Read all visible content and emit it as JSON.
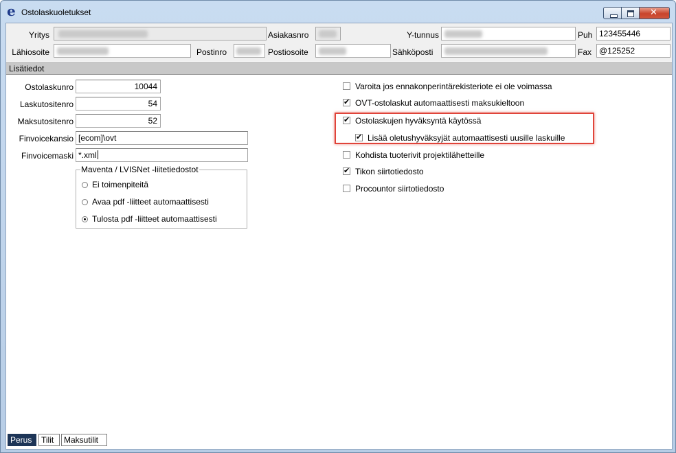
{
  "window": {
    "title": "Ostolaskuoletukset",
    "app_icon": "e"
  },
  "header": {
    "yritys_label": "Yritys",
    "asiakasnro_label": "Asiakasnro",
    "ytunnus_label": "Y-tunnus",
    "puh_label": "Puh",
    "puh_value": "123455446",
    "lahiosoite_label": "Lähiosoite",
    "postinro_label": "Postinro",
    "postiosoite_label": "Postiosoite",
    "sahkoposti_label": "Sähköposti",
    "fax_label": "Fax",
    "fax_value": "@125252"
  },
  "section": {
    "title": "Lisätiedot"
  },
  "numbers": {
    "ostolaskunro_label": "Ostolaskunro",
    "ostolaskunro_value": "10044",
    "laskutositenro_label": "Laskutositenro",
    "laskutositenro_value": "54",
    "maksutositenro_label": "Maksutositenro",
    "maksutositenro_value": "52",
    "finvoicekansio_label": "Finvoicekansio",
    "finvoicekansio_value": "[ecom]\\ovt",
    "finvoicemaski_label": "Finvoicemaski",
    "finvoicemaski_value": "*.xml"
  },
  "attachments": {
    "legend": "Maventa / LVISNet -liitetiedostot",
    "options": [
      {
        "label": "Ei toimenpiteitä",
        "selected": false
      },
      {
        "label": "Avaa pdf -liitteet automaattisesti",
        "selected": false
      },
      {
        "label": "Tulosta pdf -liitteet automaattisesti",
        "selected": true
      }
    ]
  },
  "checkboxes": [
    {
      "label": "Varoita jos ennakonperintärekisteriote ei ole voimassa",
      "checked": false
    },
    {
      "label": "OVT-ostolaskut automaattisesti maksukieltoon",
      "checked": true
    },
    {
      "label": "Ostolaskujen hyväksyntä käytössä",
      "checked": true
    },
    {
      "label": "Lisää oletushyväksyjät automaattisesti uusille laskuille",
      "checked": true
    },
    {
      "label": "Kohdista tuoterivit projektilähetteille",
      "checked": false
    },
    {
      "label": "Tikon siirtotiedosto",
      "checked": true
    },
    {
      "label": "Procountor siirtotiedosto",
      "checked": false
    }
  ],
  "tabs": [
    {
      "label": "Perus",
      "active": true
    },
    {
      "label": "Tilit",
      "active": false
    },
    {
      "label": "Maksutilit",
      "active": false
    }
  ],
  "colors": {
    "highlight": "#e0443a",
    "active_tab": "#1d3557"
  }
}
